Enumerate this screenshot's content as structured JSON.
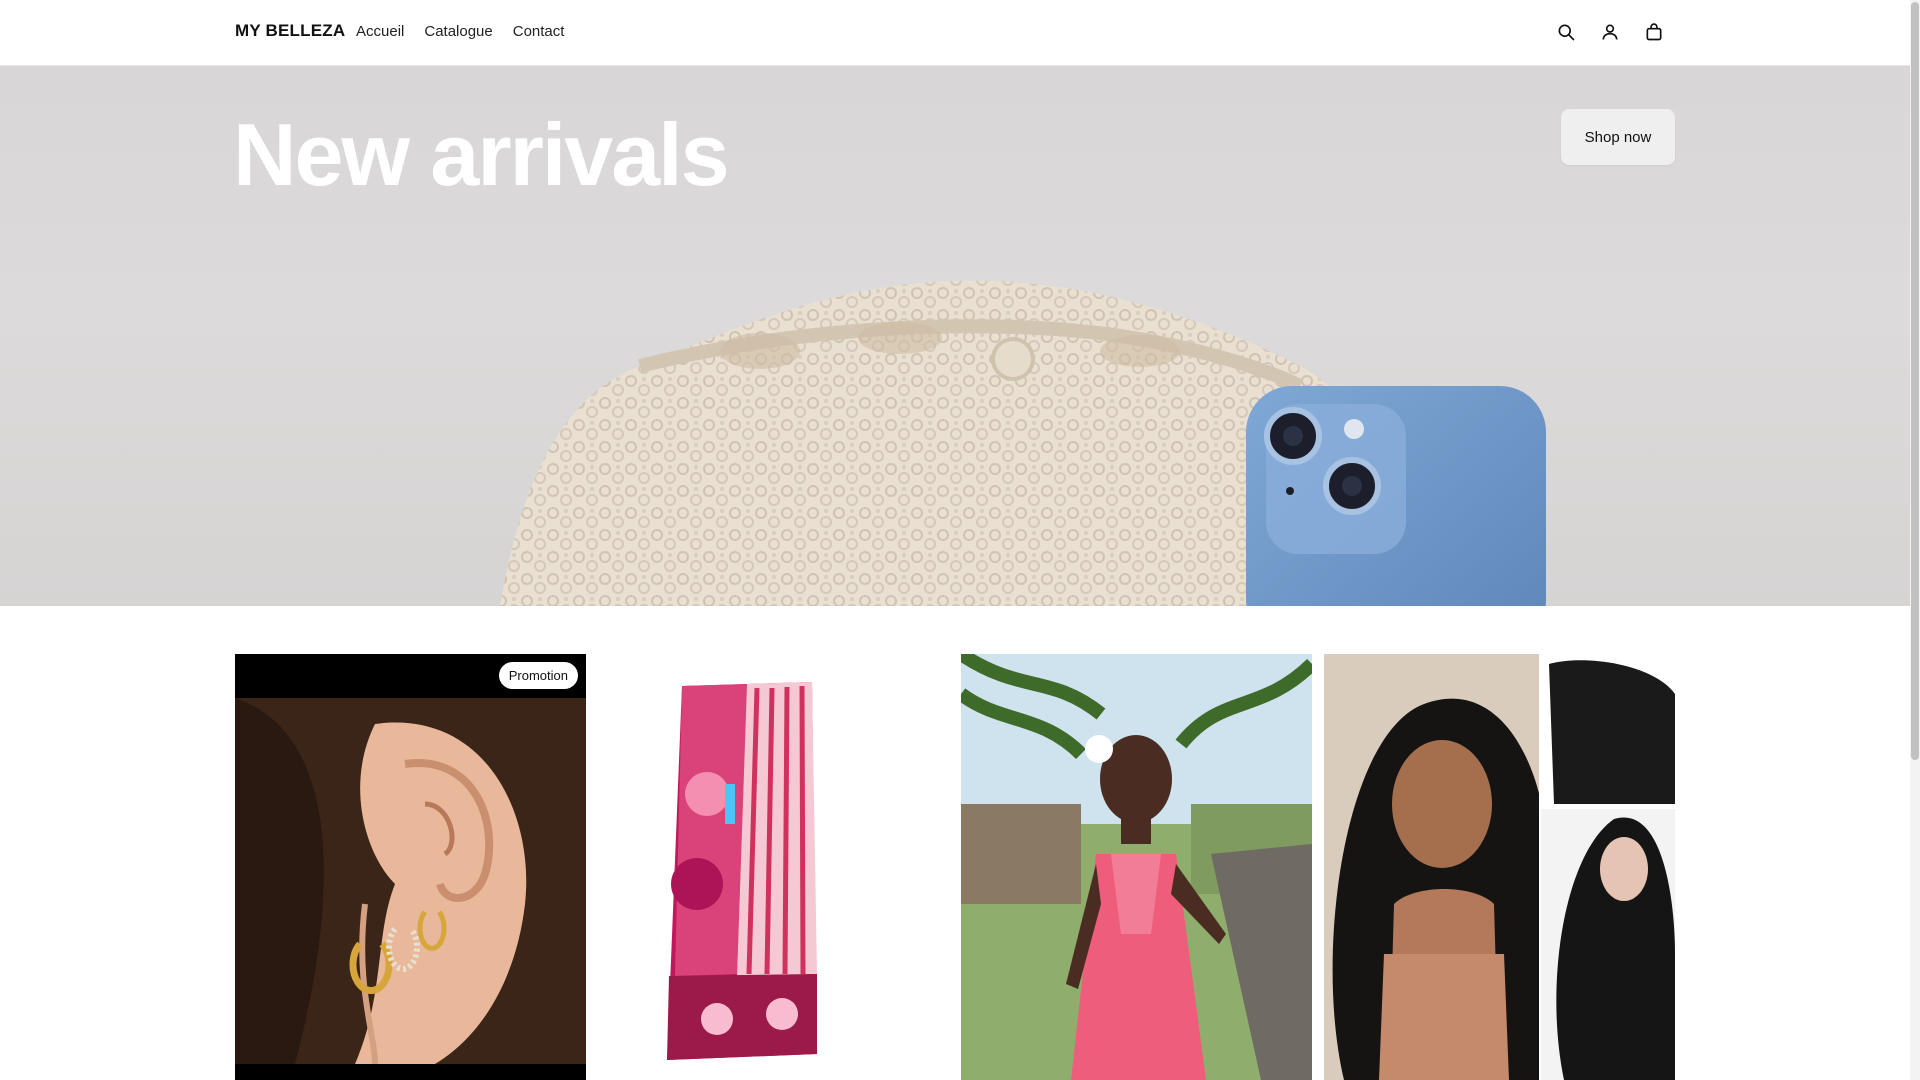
{
  "header": {
    "logo": "MY BELLEZA",
    "nav": [
      "Accueil",
      "Catalogue",
      "Contact"
    ],
    "icons": [
      "search-icon",
      "account-icon",
      "cart-icon"
    ]
  },
  "hero": {
    "title": "New arrivals",
    "cta_label": "Shop now"
  },
  "products": [
    {
      "badge": "Promotion",
      "image": "gold-hoop-earrings"
    },
    {
      "image": "pink-patchwork-skirt"
    },
    {
      "image": "pink-floral-maxi-dress"
    },
    {
      "image": "body-wave-wig"
    }
  ],
  "colors": {
    "hero_bg": "#d9d7d7",
    "text": "#111111",
    "header_bg": "#ffffff"
  }
}
